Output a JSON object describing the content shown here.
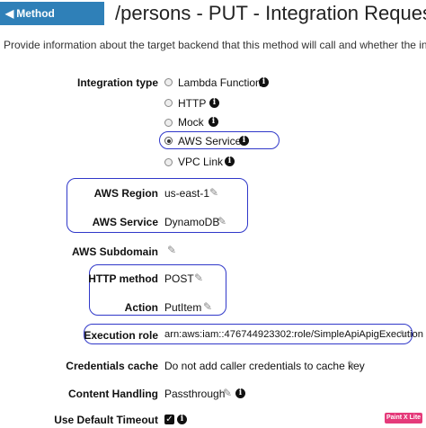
{
  "header": {
    "back_label": "Method Execution",
    "title": "/persons - PUT - Integration Request"
  },
  "description": "Provide information about the target backend that this method will call and whether the incoming req",
  "integration_type": {
    "label": "Integration type",
    "options": [
      {
        "label": "Lambda Function",
        "selected": false
      },
      {
        "label": "HTTP",
        "selected": false
      },
      {
        "label": "Mock",
        "selected": false
      },
      {
        "label": "AWS Service",
        "selected": true
      },
      {
        "label": "VPC Link",
        "selected": false
      }
    ]
  },
  "aws_region": {
    "label": "AWS Region",
    "value": "us-east-1"
  },
  "aws_service": {
    "label": "AWS Service",
    "value": "DynamoDB"
  },
  "aws_subdomain": {
    "label": "AWS Subdomain",
    "value": ""
  },
  "http_method": {
    "label": "HTTP method",
    "value": "POST"
  },
  "action": {
    "label": "Action",
    "value": "PutItem"
  },
  "execution_role": {
    "label": "Execution role",
    "value": "arn:aws:iam::476744923302:role/SimpleApiApigExecution"
  },
  "credentials_cache": {
    "label": "Credentials cache",
    "value": "Do not add caller credentials to cache key"
  },
  "content_handling": {
    "label": "Content Handling",
    "value": "Passthrough"
  },
  "default_timeout": {
    "label": "Use Default Timeout",
    "checked": true
  },
  "watermark": "Paint X Lite",
  "colors": {
    "header_bg": "#2f80b8",
    "highlight": "#3038c9"
  },
  "icons": {
    "info": "info-icon",
    "edit": "pencil-icon",
    "back": "back-arrow-icon"
  }
}
